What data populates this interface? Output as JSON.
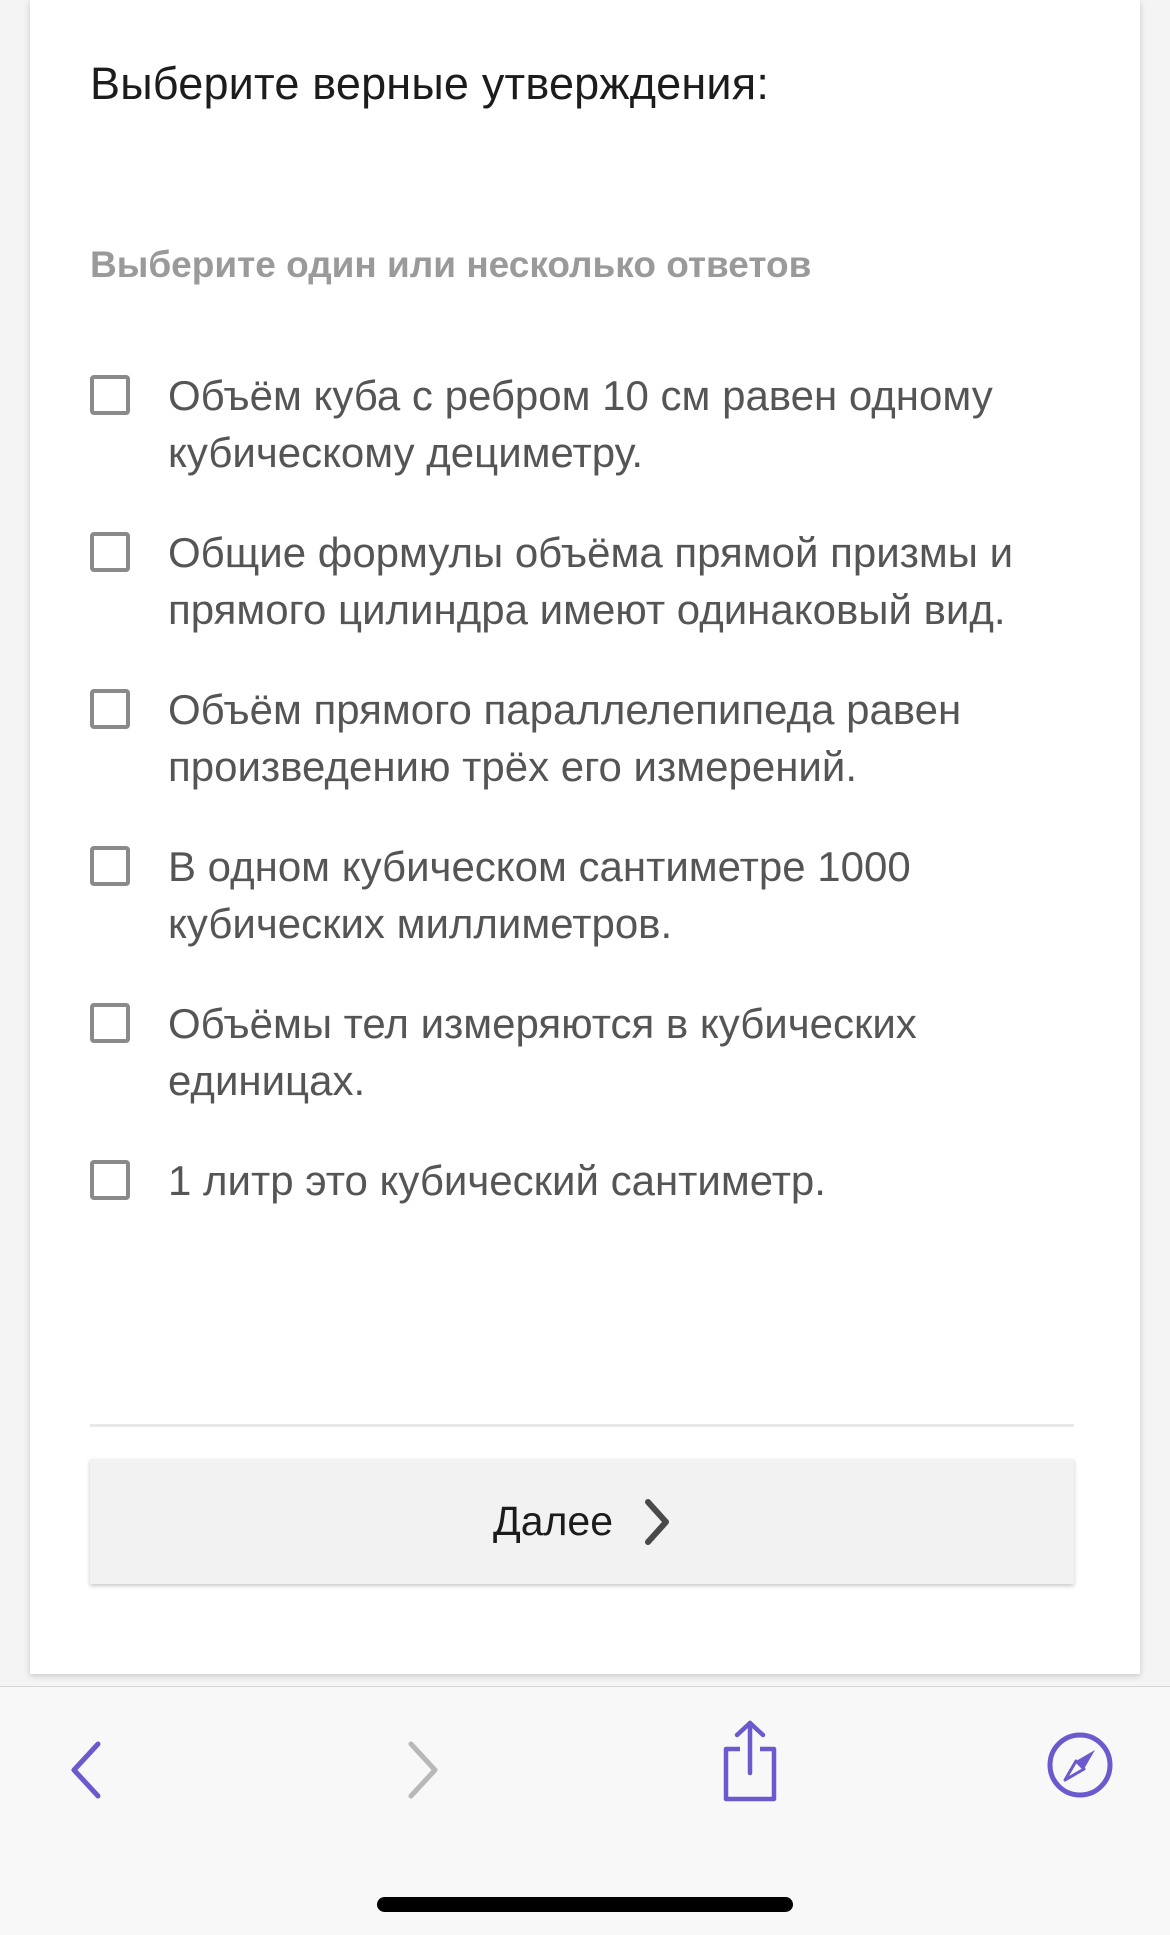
{
  "question": {
    "title": "Выберите верные утверждения:",
    "hint": "Выберите один или несколько ответов"
  },
  "options": [
    {
      "label": "Объём куба с ребром 10 см равен одному кубическому дециметру.",
      "checked": false
    },
    {
      "label": "Общие формулы объёма прямой призмы и прямого цилиндра имеют одинаковый вид.",
      "checked": false
    },
    {
      "label": "Объём прямого параллелепипеда равен произведению трёх его измерений.",
      "checked": false
    },
    {
      "label": "В одном кубическом сантиметре 1000 кубических миллиметров.",
      "checked": false
    },
    {
      "label": "Объёмы тел измеряются в кубических единицах.",
      "checked": false
    },
    {
      "label": "1 литр это кубический сантиметр.",
      "checked": false
    }
  ],
  "next_button": {
    "label": "Далее",
    "icon": "chevron-right-icon"
  },
  "toolbar": {
    "back_icon": "chevron-left-icon",
    "forward_icon": "chevron-right-icon",
    "share_icon": "share-icon",
    "safari_icon": "compass-icon",
    "accent_color": "#6a5acd",
    "disabled_color": "#b8b8b8"
  },
  "colors": {
    "card_background": "#ffffff",
    "question_text": "#1c1c1c",
    "hint_text": "#9a9a9a",
    "option_text": "#555555",
    "checkbox_border": "#8a8a8a",
    "button_background": "#f2f2f2"
  }
}
